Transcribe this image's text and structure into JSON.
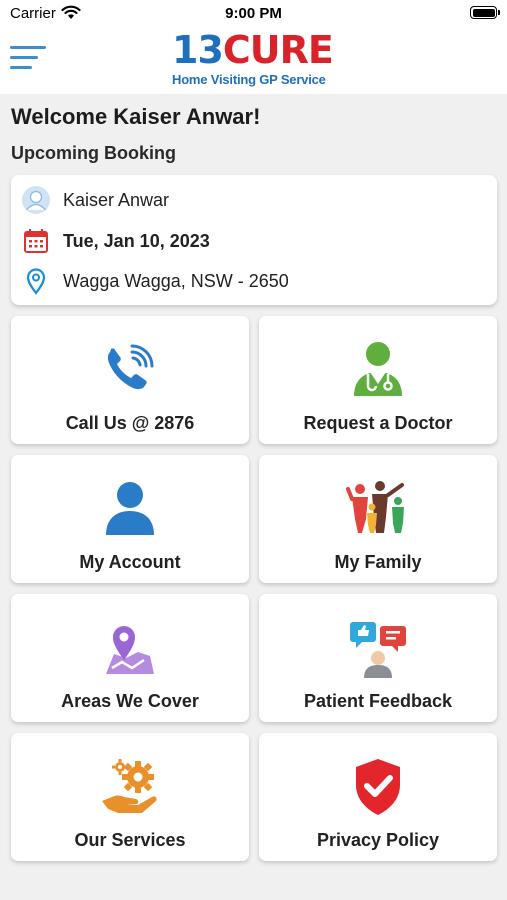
{
  "status_bar": {
    "carrier": "Carrier",
    "time": "9:00 PM"
  },
  "header": {
    "logo": {
      "number": "13",
      "word": "CURE",
      "tagline": "Home Visiting GP Service"
    }
  },
  "welcome": "Welcome Kaiser Anwar!",
  "upcoming_heading": "Upcoming Booking",
  "booking": {
    "patient": "Kaiser Anwar",
    "date": "Tue, Jan 10, 2023",
    "location": "Wagga Wagga, NSW - 2650"
  },
  "tiles": [
    {
      "label": "Call Us @ 2876",
      "icon": "phone-icon"
    },
    {
      "label": "Request a Doctor",
      "icon": "doctor-icon"
    },
    {
      "label": "My Account",
      "icon": "user-icon"
    },
    {
      "label": "My Family",
      "icon": "family-icon"
    },
    {
      "label": "Areas We Cover",
      "icon": "map-pin-icon"
    },
    {
      "label": "Patient Feedback",
      "icon": "feedback-icon"
    },
    {
      "label": "Our Services",
      "icon": "services-gear-icon"
    },
    {
      "label": "Privacy Policy",
      "icon": "shield-check-icon"
    }
  ],
  "colors": {
    "brand_blue": "#1f6fbf",
    "brand_red": "#d9232a",
    "menu_blue": "#3b8ed3",
    "background": "#f0f0f0"
  }
}
